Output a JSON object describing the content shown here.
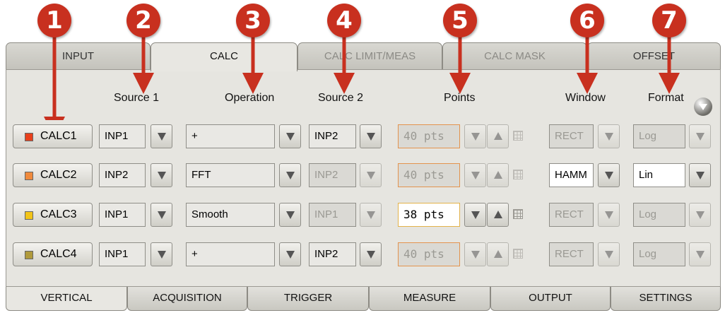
{
  "callouts": [
    "1",
    "2",
    "3",
    "4",
    "5",
    "6",
    "7"
  ],
  "tabs": [
    "INPUT",
    "CALC",
    "CALC LIMIT/MEAS",
    "CALC MASK",
    "OFFSET"
  ],
  "columns": {
    "source1": "Source 1",
    "operation": "Operation",
    "source2": "Source 2",
    "points": "Points",
    "window": "Window",
    "format": "Format"
  },
  "rows": [
    {
      "name": "CALC1",
      "color": "#e8401c",
      "source1": "INP1",
      "operation": "+",
      "source2": "INP2",
      "points": "40 pts",
      "window": "RECT",
      "format": "Log"
    },
    {
      "name": "CALC2",
      "color": "#f08a3c",
      "source1": "INP2",
      "operation": "FFT",
      "source2": "INP2",
      "points": "40 pts",
      "window": "HAMM",
      "format": "Lin"
    },
    {
      "name": "CALC3",
      "color": "#f2c418",
      "source1": "INP1",
      "operation": "Smooth",
      "source2": "INP1",
      "points": "38 pts",
      "window": "RECT",
      "format": "Log"
    },
    {
      "name": "CALC4",
      "color": "#b09a3c",
      "source1": "INP1",
      "operation": "+",
      "source2": "INP2",
      "points": "40 pts",
      "window": "RECT",
      "format": "Log"
    }
  ],
  "bottom_tabs": [
    "VERTICAL",
    "ACQUISITION",
    "TRIGGER",
    "MEASURE",
    "OUTPUT",
    "SETTINGS"
  ]
}
